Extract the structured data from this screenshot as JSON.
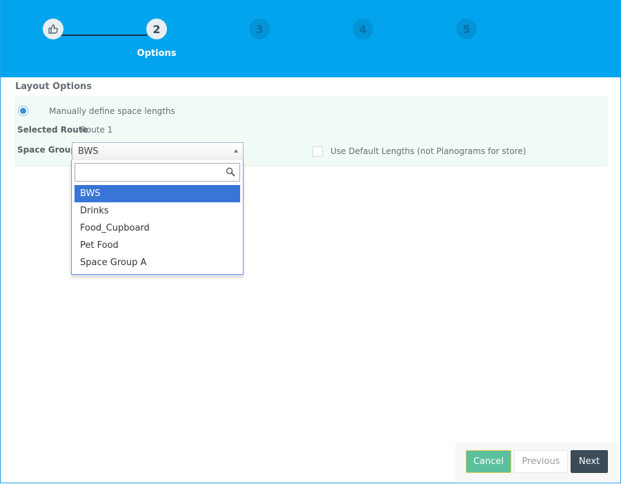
{
  "stepper": {
    "steps": [
      {
        "number": "",
        "icon": "thumbs-up-icon",
        "state": "done"
      },
      {
        "number": "2",
        "state": "active",
        "label": "Options"
      },
      {
        "number": "3",
        "state": "pending"
      },
      {
        "number": "4",
        "state": "pending"
      },
      {
        "number": "5",
        "state": "pending"
      }
    ]
  },
  "layout_options": {
    "title": "Layout Options",
    "radio_label": "Manually define space lengths",
    "selected_route_label": "Selected Route",
    "selected_route_value": "Route 1",
    "space_group_label": "Space Group",
    "space_group_value": "BWS",
    "search_placeholder": "",
    "dropdown_options": [
      "BWS",
      "Drinks",
      "Food_Cupboard",
      "Pet Food",
      "Space Group A"
    ],
    "selected_option": "BWS",
    "default_lengths_label": "Use Default Lengths (not Planograms for store)"
  },
  "footer": {
    "cancel_label": "Cancel",
    "previous_label": "Previous",
    "next_label": "Next"
  },
  "colors": {
    "header": "#03a4ee",
    "selected_option": "#3875d7",
    "cancel_button": "#5cbf9e",
    "next_button": "#3b4b57"
  }
}
